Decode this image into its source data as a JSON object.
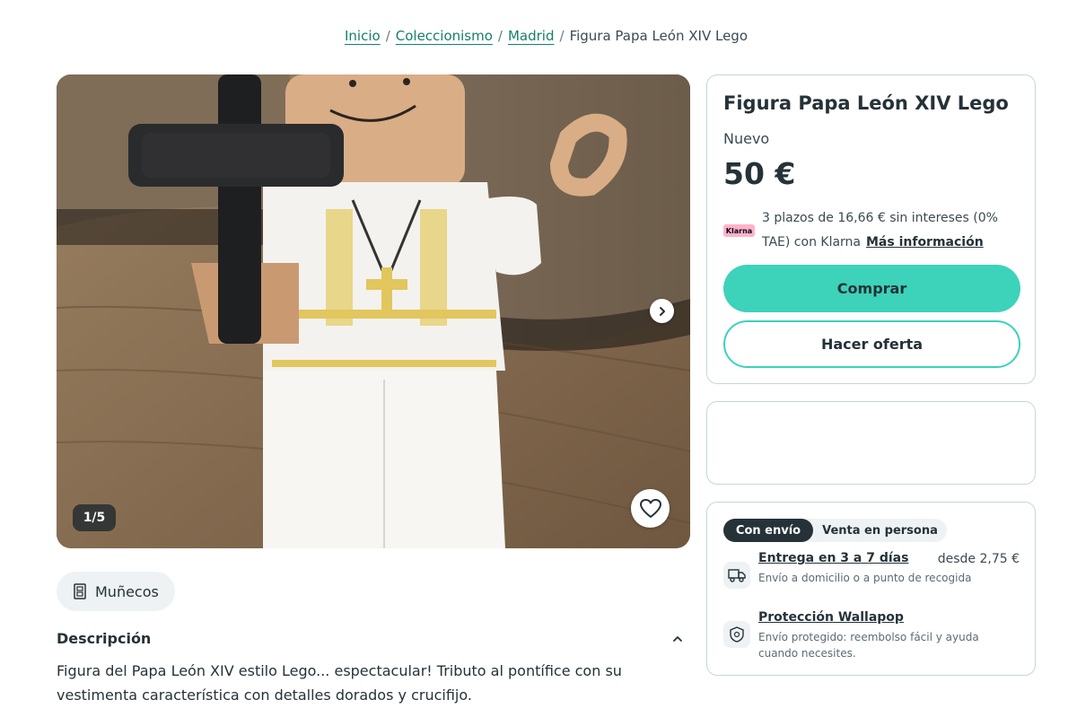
{
  "breadcrumb": {
    "items": [
      "Inicio",
      "Coleccionismo",
      "Madrid"
    ],
    "current": "Figura Papa León XIV Lego",
    "separator": "/"
  },
  "gallery": {
    "counter": "1/5",
    "next_icon": "chevron-right-icon",
    "favorite_icon": "heart-icon"
  },
  "category_chip": {
    "icon": "doll-icon",
    "label": "Muñecos"
  },
  "description": {
    "title": "Descripción",
    "text": "Figura del Papa León XIV estilo Lego... espectacular! Tributo al pontífice con su vestimenta característica con detalles dorados y crucifijo."
  },
  "product": {
    "title": "Figura Papa León XIV Lego",
    "condition": "Nuevo",
    "price": "50 €",
    "klarna": {
      "badge": "Klarna",
      "text": "3 plazos de 16,66 € sin intereses (0% TAE) con Klarna",
      "link": "Más información"
    },
    "buy_label": "Comprar",
    "offer_label": "Hacer oferta"
  },
  "shipping": {
    "tabs": [
      "Con envío",
      "Venta en persona"
    ],
    "active_tab": "Con envío",
    "delivery": {
      "icon": "truck-icon",
      "title": "Entrega en 3 a 7 días",
      "subtitle": "Envío a domicilio o a punto de recogida",
      "price": "desde 2,75 €"
    },
    "protection": {
      "icon": "shield-icon",
      "title": "Protección Wallapop",
      "subtitle": "Envío protegido: reembolso fácil y ayuda cuando necesites."
    }
  },
  "colors": {
    "accent": "#3dd2ba",
    "link": "#13806b",
    "text": "#253238",
    "border": "#c5d6da",
    "klarna": "#ffb3c7"
  }
}
